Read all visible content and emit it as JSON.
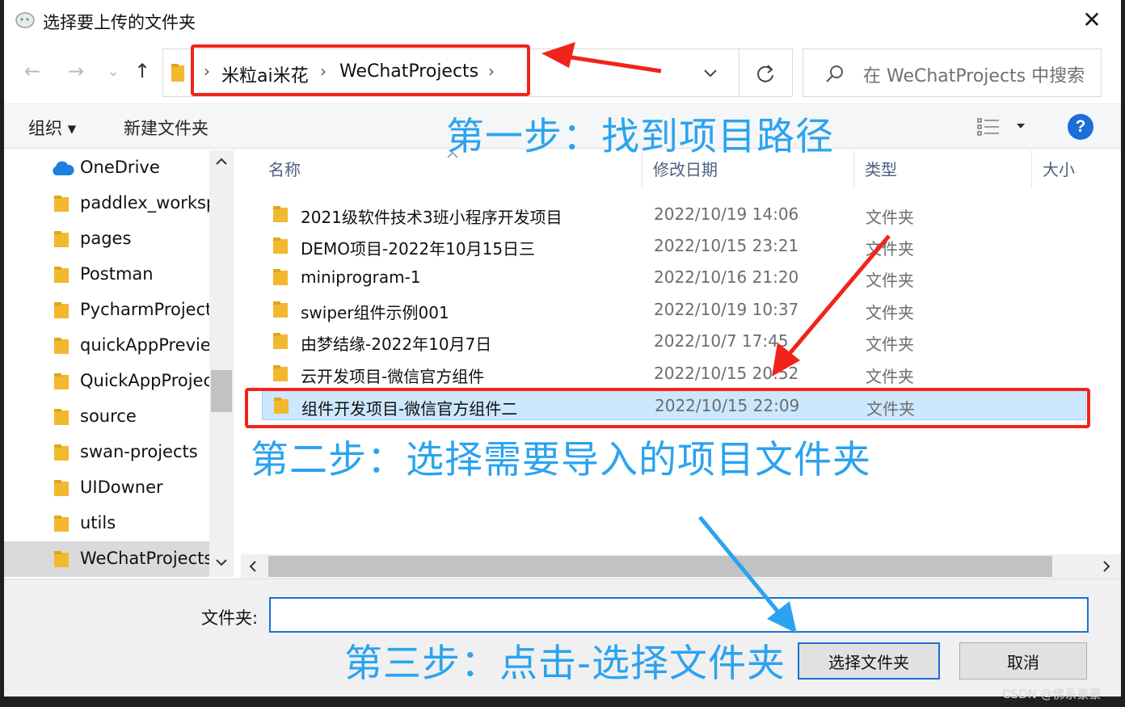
{
  "window": {
    "title": "选择要上传的文件夹",
    "close_symbol": "✕"
  },
  "nav": {
    "back": "←",
    "forward": "→",
    "recent": "⌄",
    "up": "↑"
  },
  "address": {
    "crumbs": [
      "米粒ai米花",
      "WeChatProjects"
    ],
    "sep": "›"
  },
  "search": {
    "placeholder": "在 WeChatProjects 中搜索"
  },
  "toolbar": {
    "organize": "组织 ▾",
    "new_folder": "新建文件夹",
    "help": "?"
  },
  "sidebar": {
    "items": [
      {
        "label": "OneDrive",
        "icon": "cloud-icon"
      },
      {
        "label": "paddlex_workspace",
        "icon": "folder-icon"
      },
      {
        "label": "pages",
        "icon": "folder-icon"
      },
      {
        "label": "Postman",
        "icon": "folder-icon"
      },
      {
        "label": "PycharmProjects",
        "icon": "folder-icon"
      },
      {
        "label": "quickAppPreview",
        "icon": "folder-icon"
      },
      {
        "label": "QuickAppProjects",
        "icon": "folder-icon"
      },
      {
        "label": "source",
        "icon": "folder-icon"
      },
      {
        "label": "swan-projects",
        "icon": "folder-icon"
      },
      {
        "label": "UIDowner",
        "icon": "folder-icon"
      },
      {
        "label": "utils",
        "icon": "folder-icon"
      },
      {
        "label": "WeChatProjects",
        "icon": "folder-icon",
        "selected": true
      }
    ]
  },
  "columns": {
    "name": "名称",
    "modified": "修改日期",
    "type": "类型",
    "size": "大小"
  },
  "files": [
    {
      "name": "2021级软件技术3班小程序开发项目",
      "date": "2022/10/19 14:06",
      "type": "文件夹"
    },
    {
      "name": "DEMO项目-2022年10月15日三",
      "date": "2022/10/15 23:21",
      "type": "文件夹"
    },
    {
      "name": "miniprogram-1",
      "date": "2022/10/16 21:20",
      "type": "文件夹"
    },
    {
      "name": "swiper组件示例001",
      "date": "2022/10/19 10:37",
      "type": "文件夹"
    },
    {
      "name": "由梦结缘-2022年10月7日",
      "date": "2022/10/7 17:45",
      "type": "文件夹"
    },
    {
      "name": "云开发项目-微信官方组件",
      "date": "2022/10/15 20:52",
      "type": "文件夹"
    },
    {
      "name": "组件开发项目-微信官方组件二",
      "date": "2022/10/15 22:09",
      "type": "文件夹",
      "selected": true
    }
  ],
  "bottom": {
    "folder_label": "文件夹:",
    "folder_value": "",
    "select_label": "选择文件夹",
    "cancel_label": "取消"
  },
  "annotations": {
    "step1": "第一步：找到项目路径",
    "step2": "第二步：选择需要导入的项目文件夹",
    "step3": "第三步：点击-选择文件夹"
  },
  "watermark": "CSDN @佛系豪豪",
  "colors": {
    "accent": "#1b6fd6",
    "annotation_red": "#f0241b",
    "annotation_blue": "#2aa3f0",
    "folder": "#f2b82e",
    "selected_row": "#cce8ff"
  }
}
